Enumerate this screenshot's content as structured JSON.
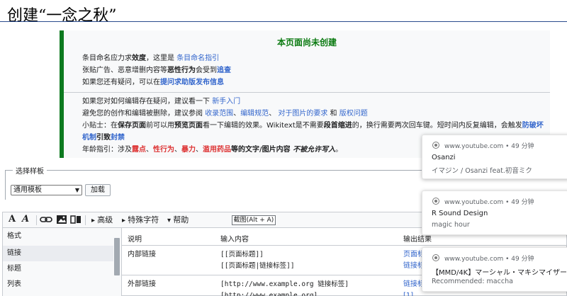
{
  "page": {
    "title": "创建“一念之秋”"
  },
  "notice": {
    "heading": "本页面尚未创建",
    "list1": [
      {
        "a": "条目命名应力求",
        "b": "效度",
        "c": "，这里是 ",
        "link": "条目命名指引"
      },
      {
        "a": "张贴广告、恶意增删内容等",
        "b": "恶性行为",
        "c": "会受到",
        "link": "追查"
      },
      {
        "a": "如果您还有疑问，可以在",
        "link": "提问求助版发布信息"
      }
    ],
    "list2_item1": {
      "a": "如果您对如何编辑存在疑问，建议看一下 ",
      "link": "新手入门"
    },
    "list2_item2": {
      "a": "避免您的创作和编辑被删除，建议参阅 ",
      "l1": "收录范围",
      "s1": "、",
      "l2": "编辑规范",
      "s2": "、 ",
      "l3": "对于图片的要求",
      "s3": " 和 ",
      "l4": "版权问题"
    },
    "list2_item3": {
      "a": "小贴士：在",
      "b1": "保存页面",
      "c": "前可以用",
      "b2": "预览页面",
      "d": "看一下编辑的效果。Wikitext是不需要",
      "b3": "段首缩进",
      "e": "的，换行需要两次回车键。短时间内反复编辑，会触发",
      "link": "防破坏机制",
      "f": "引致",
      "link2": "封禁"
    },
    "list2_item4": {
      "a": "年龄指引：涉及",
      "r1": "露点",
      "s1": "、",
      "r2": "性行为",
      "s2": "、",
      "r3": "暴力",
      "s3": "、",
      "r4": "滥用药品",
      "b": "等的文字/图片内容 ",
      "ib": "不被允许写入",
      "end": "。"
    }
  },
  "templates": {
    "legend": "选择样板",
    "selected": "通用模板",
    "load_button": "加载"
  },
  "toolbar": {
    "bold": "A",
    "italic": "A",
    "advanced": "高级",
    "special_chars": "特殊字符",
    "help": "帮助",
    "tooltip": "截图(Alt + A)"
  },
  "help": {
    "sidebar": [
      "格式",
      "链接",
      "标题",
      "列表"
    ],
    "active_index": 1,
    "headers": {
      "desc": "说明",
      "input": "输入内容",
      "output": "输出结果"
    },
    "rows": [
      {
        "desc": "内部链接",
        "input": [
          "[[页面标题]]",
          "[[页面标题|链接标签]]"
        ],
        "output": [
          "页面标",
          "链接标"
        ]
      },
      {
        "desc": "外部链接",
        "input": [
          "[http://www.example.org 链接标签]",
          "[http://www.example.org]"
        ],
        "output": [
          "链接标",
          "[1]"
        ]
      }
    ]
  },
  "notifications": [
    {
      "source": "www.youtube.com",
      "time": "49 分钟",
      "title": "Osanzi",
      "subtitle": "イマジン / Osanzi feat.初音ミク"
    },
    {
      "source": "www.youtube.com",
      "time": "49 分钟",
      "title": "R Sound Design",
      "subtitle": "magic hour"
    },
    {
      "source": "www.youtube.com",
      "time": "49 分钟",
      "title": "【MMD/4K】マーシャル・マキシマイザー...",
      "subtitle": "Recommended: maccha"
    }
  ],
  "colors": {
    "notice_border": "#0a7a10",
    "link": "#3366cc",
    "warning": "#dd3333"
  }
}
